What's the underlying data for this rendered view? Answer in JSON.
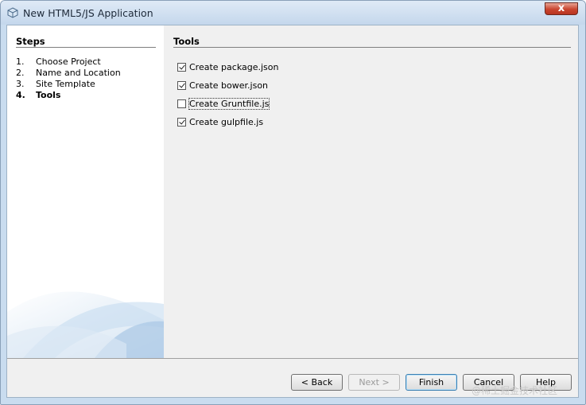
{
  "window": {
    "title": "New HTML5/JS Application",
    "close_label": "x"
  },
  "steps": {
    "title": "Steps",
    "items": [
      {
        "num": "1.",
        "label": "Choose Project",
        "current": false
      },
      {
        "num": "2.",
        "label": "Name and Location",
        "current": false
      },
      {
        "num": "3.",
        "label": "Site Template",
        "current": false
      },
      {
        "num": "4.",
        "label": "Tools",
        "current": true
      }
    ]
  },
  "content": {
    "title": "Tools",
    "options": [
      {
        "label": "Create package.json",
        "checked": true
      },
      {
        "label": "Create bower.json",
        "checked": true
      },
      {
        "label": "Create Gruntfile.js",
        "checked": false
      },
      {
        "label": "Create gulpfile.js",
        "checked": true
      }
    ]
  },
  "buttons": {
    "back": "< Back",
    "next": "Next >",
    "finish": "Finish",
    "cancel": "Cancel",
    "help": "Help"
  },
  "watermark": "@稀土掘金技术社区"
}
